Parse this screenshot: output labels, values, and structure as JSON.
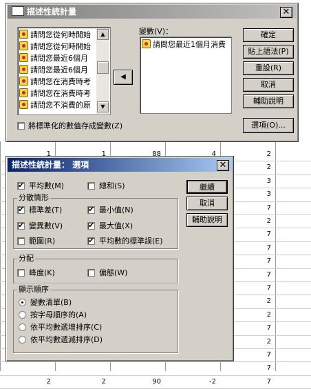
{
  "background_rows": [
    {
      "c1": "1",
      "c2": "1",
      "c3": "88",
      "c4": "4",
      "c5": "2"
    },
    {
      "c1": "",
      "c2": "",
      "c3": "",
      "c4": "",
      "c5": "2"
    },
    {
      "c1": "",
      "c2": "",
      "c3": "",
      "c4": "",
      "c5": "3"
    },
    {
      "c1": "",
      "c2": "",
      "c3": "",
      "c4": "",
      "c5": "3"
    },
    {
      "c1": "",
      "c2": "",
      "c3": "",
      "c4": "",
      "c5": "7"
    },
    {
      "c1": "",
      "c2": "",
      "c3": "",
      "c4": "",
      "c5": "2"
    },
    {
      "c1": "",
      "c2": "",
      "c3": "",
      "c4": "",
      "c5": "7"
    },
    {
      "c1": "",
      "c2": "",
      "c3": "",
      "c4": "",
      "c5": "7"
    },
    {
      "c1": "",
      "c2": "",
      "c3": "",
      "c4": "",
      "c5": "7"
    },
    {
      "c1": "",
      "c2": "",
      "c3": "",
      "c4": "",
      "c5": "7"
    },
    {
      "c1": "",
      "c2": "",
      "c3": "",
      "c4": "",
      "c5": "7"
    },
    {
      "c1": "",
      "c2": "",
      "c3": "",
      "c4": "",
      "c5": "2"
    },
    {
      "c1": "",
      "c2": "",
      "c3": "",
      "c4": "",
      "c5": "2"
    },
    {
      "c1": "",
      "c2": "",
      "c3": "",
      "c4": "",
      "c5": "7"
    },
    {
      "c1": "",
      "c2": "",
      "c3": "",
      "c4": "",
      "c5": "2"
    },
    {
      "c1": "",
      "c2": "",
      "c3": "",
      "c4": "",
      "c5": "7"
    },
    {
      "c1": "",
      "c2": "",
      "c3": "",
      "c4": "",
      "c5": "7"
    },
    {
      "c1": "2",
      "c2": "2",
      "c3": "90",
      "c4": "-2",
      "c5": "7"
    }
  ],
  "main_dialog": {
    "title": "描述性統計量",
    "close_glyph": "✕",
    "source_items": [
      "請問您從何時開始",
      "請問您從何時開始",
      "請問您最近6個月",
      "請問您最近6個月",
      "請問您在消費時考",
      "請問您在消費時考",
      "請問您不消費的原"
    ],
    "move_arrow": "◀",
    "variables_label": "變數(V)：",
    "selected_variables": [
      "請問您最近1個月消費"
    ],
    "buttons": {
      "ok": "確定",
      "paste": "貼上語法(P)",
      "reset": "重設(R)",
      "cancel": "取消",
      "help": "輔助說明",
      "options": "選項(O)..."
    },
    "save_standardized": {
      "label": "將標準化的數值存成變數(Z)",
      "checked": false
    }
  },
  "options_dialog": {
    "title": "描述性統計量： 選項",
    "close_glyph": "✕",
    "mean": {
      "label": "平均數(M)",
      "checked": true
    },
    "sum": {
      "label": "總和(S)",
      "checked": false
    },
    "dispersion": {
      "title": "分散情形",
      "std": {
        "label": "標準差(T)",
        "checked": true
      },
      "min": {
        "label": "最小值(N)",
        "checked": true
      },
      "variance": {
        "label": "變異數(V)",
        "checked": true
      },
      "max": {
        "label": "最大值(X)",
        "checked": true
      },
      "range": {
        "label": "範圍(R)",
        "checked": false
      },
      "se_mean": {
        "label": "平均數的標準誤(E)",
        "checked": true
      }
    },
    "distribution": {
      "title": "分配",
      "kurtosis": {
        "label": "峰度(K)",
        "checked": false
      },
      "skewness": {
        "label": "偏態(W)",
        "checked": false
      }
    },
    "display_order": {
      "title": "顯示順序",
      "options": [
        {
          "label": "變數清單(B)",
          "selected": true
        },
        {
          "label": "按字母順序的(A)",
          "selected": false
        },
        {
          "label": "依平均數遞增排序(C)",
          "selected": false
        },
        {
          "label": "依平均數遞減排序(D)",
          "selected": false
        }
      ]
    },
    "buttons": {
      "continue": "繼續",
      "cancel": "取消",
      "help": "輔助說明"
    }
  },
  "colors": {
    "title_start": "#0a246a",
    "title_end": "#a6caf0",
    "inactive_title_start": "#808080",
    "inactive_title_end": "#c0c0c0",
    "face": "#d4d0c8"
  },
  "check_glyph": "✔"
}
